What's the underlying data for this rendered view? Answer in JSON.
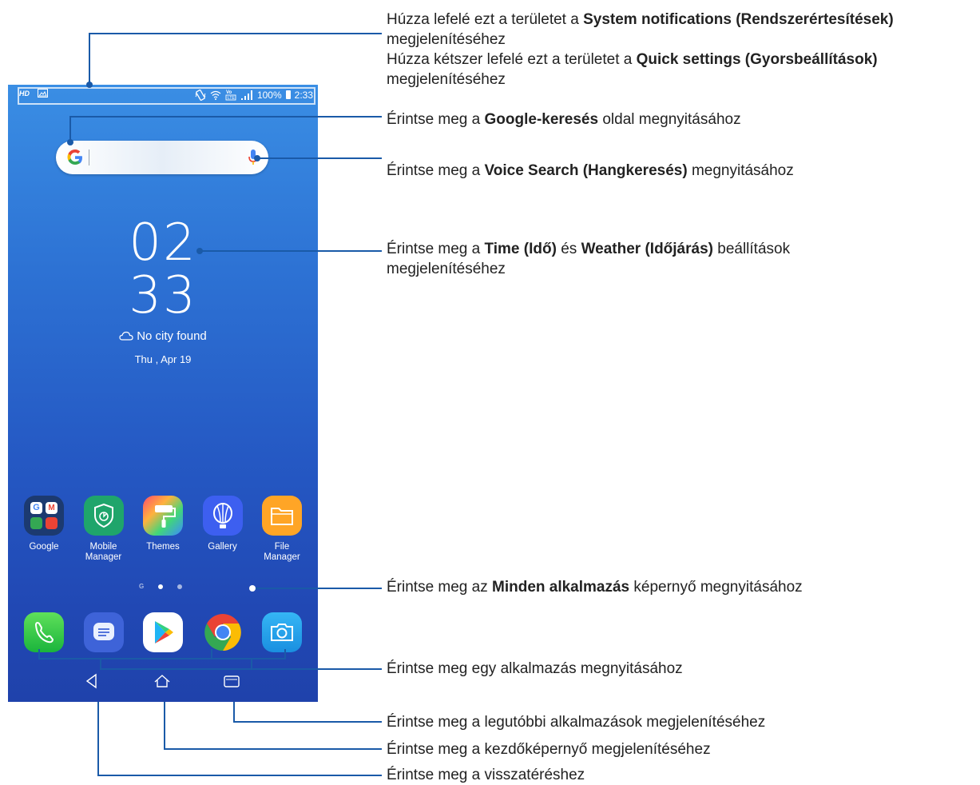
{
  "status_bar": {
    "hd_label": "HD",
    "battery_text": "100%",
    "time": "2:33"
  },
  "search": {
    "google_letter": "G"
  },
  "clock": {
    "hours": "02",
    "minutes": "33"
  },
  "weather": {
    "city_text": "No city found",
    "date": "Thu , Apr 19"
  },
  "apps": [
    {
      "label": "Google",
      "icon": "google-folder-icon"
    },
    {
      "label": "Mobile\nManager",
      "icon": "mobile-manager-icon"
    },
    {
      "label": "Themes",
      "icon": "themes-icon"
    },
    {
      "label": "Gallery",
      "icon": "gallery-icon"
    },
    {
      "label": "File\nManager",
      "icon": "file-manager-icon"
    }
  ],
  "dock": [
    {
      "icon": "phone-icon"
    },
    {
      "icon": "messages-icon"
    },
    {
      "icon": "play-store-icon"
    },
    {
      "icon": "chrome-icon"
    },
    {
      "icon": "camera-icon"
    }
  ],
  "page_indicator": {
    "g_label": "G"
  },
  "navbar": {
    "buttons": [
      "back-icon",
      "home-icon",
      "recents-icon"
    ]
  },
  "callouts": {
    "notifications": {
      "line1_pre": "Húzza lefelé ezt a területet a ",
      "line1_bold": "System notifications (Rendszerértesítések)",
      "line2": "megjelenítéséhez",
      "line3_pre": "Húzza kétszer lefelé ezt a területet a ",
      "line3_bold": "Quick settings (Gyorsbeállítások)",
      "line4": "megjelenítéséhez"
    },
    "google_search": {
      "pre": "Érintse meg a ",
      "bold": "Google-keresés",
      "post": " oldal megnyitásához"
    },
    "voice_search": {
      "pre": "Érintse meg a ",
      "bold": "Voice Search (Hangkeresés)",
      "post": " megnyitásához"
    },
    "time_weather": {
      "pre": "Érintse meg a ",
      "bold1": "Time (Idő)",
      "mid": " és ",
      "bold2": "Weather (Időjárás)",
      "post": " beállítások",
      "line2": "megjelenítéséhez"
    },
    "all_apps": {
      "pre": "Érintse meg az ",
      "bold": "Minden alkalmazás",
      "post": " képernyő megnyitásához"
    },
    "open_app": "Érintse meg egy alkalmazás megnyitásához",
    "recents": "Érintse meg a legutóbbi alkalmazások megjelenítéséhez",
    "home": "Érintse meg a kezdőképernyő megjelenítéséhez",
    "back": "Érintse meg a visszatéréshez"
  },
  "colors": {
    "callout_line": "#1a5aa8",
    "wallpaper_top": "#3a8ee4",
    "wallpaper_bottom": "#1f42ab"
  }
}
